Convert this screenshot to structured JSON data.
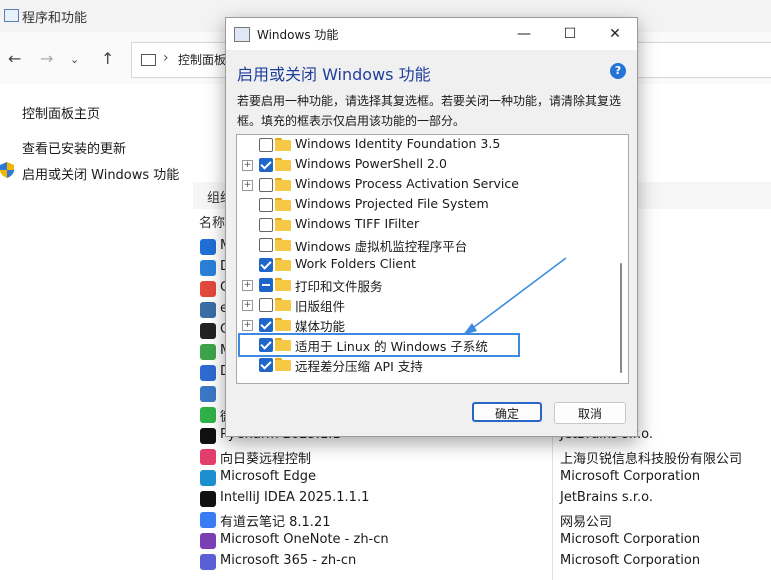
{
  "background_window": {
    "title": "程序和功能",
    "address": "控制面板",
    "left_links": [
      "控制面板主页",
      "查看已安装的更新",
      "启用或关闭 Windows 功能"
    ],
    "toolbar_label": "组织",
    "column_header": "名称",
    "programs": [
      {
        "name": "M",
        "publisher": "rporation",
        "icon_color": "#1f6fd6"
      },
      {
        "name": "D",
        "publisher": "",
        "icon_color": "#2b7fd8"
      },
      {
        "name": "G",
        "publisher": "",
        "icon_color": "#e24a3b"
      },
      {
        "name": "e",
        "publisher": "",
        "icon_color": "#3a6ea5"
      },
      {
        "name": "C",
        "publisher": "",
        "icon_color": "#222222"
      },
      {
        "name": "M",
        "publisher": "",
        "icon_color": "#3fa34d"
      },
      {
        "name": "D",
        "publisher": "",
        "icon_color": "#2e6ad1"
      },
      {
        "name": "",
        "publisher": "",
        "icon_color": "#3b78c6"
      },
      {
        "name": "微",
        "publisher": "有限公司",
        "icon_color": "#2fb24a"
      },
      {
        "name": "PyCharm 2025.1.1",
        "publisher": "JetBrains s.r.o.",
        "icon_color": "#111111"
      },
      {
        "name": "向日葵远程控制",
        "publisher": "上海贝锐信息科技股份有限公司",
        "icon_color": "#e23d6b"
      },
      {
        "name": "Microsoft Edge",
        "publisher": "Microsoft Corporation",
        "icon_color": "#1d8fd0"
      },
      {
        "name": "IntelliJ IDEA 2025.1.1.1",
        "publisher": "JetBrains s.r.o.",
        "icon_color": "#111111"
      },
      {
        "name": "有道云笔记 8.1.21",
        "publisher": "网易公司",
        "icon_color": "#3a7cf2"
      },
      {
        "name": "Microsoft OneNote - zh-cn",
        "publisher": "Microsoft Corporation",
        "icon_color": "#7b3fb3"
      },
      {
        "name": "Microsoft 365 - zh-cn",
        "publisher": "Microsoft Corporation",
        "icon_color": "#5a5fd6"
      }
    ]
  },
  "dialog": {
    "title": "Windows 功能",
    "heading": "启用或关闭 Windows 功能",
    "help": "?",
    "description": "若要启用一种功能，请选择其复选框。若要关闭一种功能，请清除其复选框。填充的框表示仅启用该功能的一部分。",
    "features": [
      {
        "label": "Windows Identity Foundation 3.5",
        "state": "unchecked",
        "expandable": false
      },
      {
        "label": "Windows PowerShell 2.0",
        "state": "checked",
        "expandable": true
      },
      {
        "label": "Windows Process Activation Service",
        "state": "unchecked",
        "expandable": true
      },
      {
        "label": "Windows Projected File System",
        "state": "unchecked",
        "expandable": false
      },
      {
        "label": "Windows TIFF IFilter",
        "state": "unchecked",
        "expandable": false
      },
      {
        "label": "Windows 虚拟机监控程序平台",
        "state": "unchecked",
        "expandable": false
      },
      {
        "label": "Work Folders Client",
        "state": "checked",
        "expandable": false
      },
      {
        "label": "打印和文件服务",
        "state": "partial",
        "expandable": true
      },
      {
        "label": "旧版组件",
        "state": "unchecked",
        "expandable": true
      },
      {
        "label": "媒体功能",
        "state": "checked",
        "expandable": true
      },
      {
        "label": "适用于 Linux 的 Windows 子系统",
        "state": "checked",
        "expandable": false
      },
      {
        "label": "远程差分压缩 API 支持",
        "state": "checked",
        "expandable": false
      }
    ],
    "ok_label": "确定",
    "cancel_label": "取消"
  },
  "colors": {
    "accent": "#1e66c9",
    "highlight_box": "#3c8be0",
    "arrow": "#3c8be0",
    "heading": "#1f3f9c"
  }
}
